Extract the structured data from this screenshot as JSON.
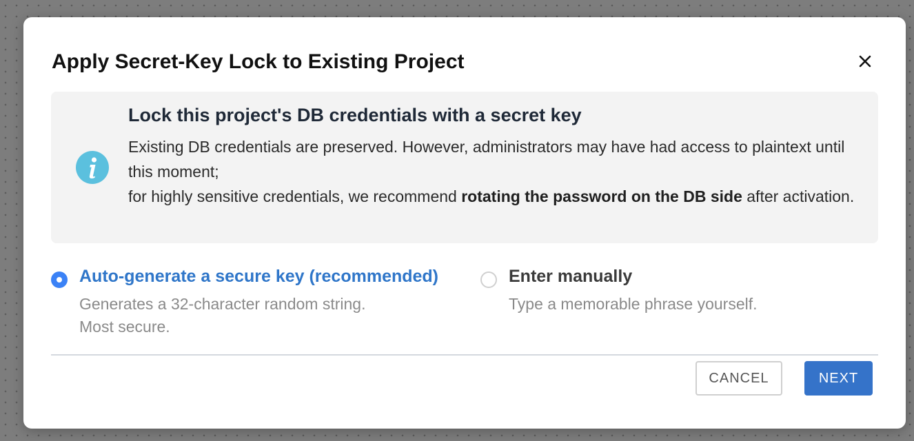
{
  "dialog": {
    "title": "Apply Secret-Key Lock to Existing Project"
  },
  "info": {
    "heading": "Lock this project's DB credentials with a secret key",
    "line1": "Existing DB credentials are preserved. However, administrators may have had access to plaintext until this moment;",
    "line2_prefix": "for highly sensitive credentials, we recommend ",
    "line2_bold": "rotating the password on the DB side",
    "line2_suffix": " after activation.",
    "icon": "info-icon"
  },
  "options": {
    "auto": {
      "label": "Auto-generate a secure key (recommended)",
      "desc_line1": "Generates a 32-character random string.",
      "desc_line2": "Most secure.",
      "selected": true
    },
    "manual": {
      "label": "Enter manually",
      "desc": "Type a memorable phrase yourself.",
      "selected": false
    }
  },
  "buttons": {
    "cancel": "CANCEL",
    "next": "NEXT"
  },
  "colors": {
    "accent": "#3573c9",
    "selected_label": "#2f76c9",
    "info_icon": "#5bc0de",
    "info_bg": "#f3f3f3"
  }
}
